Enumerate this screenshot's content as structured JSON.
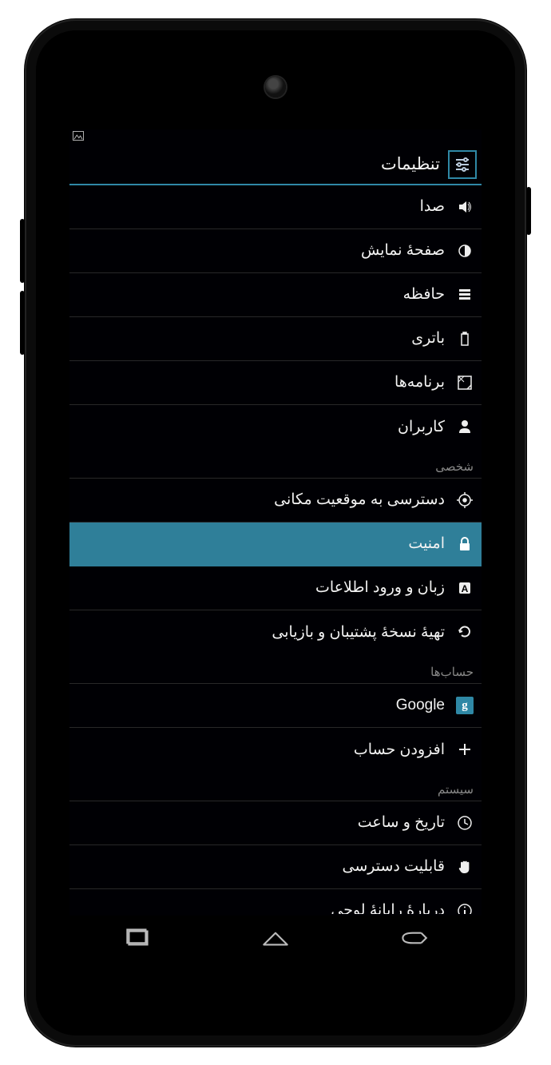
{
  "header": {
    "title": "تنظیمات"
  },
  "sections": {
    "device_rows": [
      {
        "id": "sound",
        "label": "صدا"
      },
      {
        "id": "display",
        "label": "صفحهٔ نمایش"
      },
      {
        "id": "storage",
        "label": "حافظه"
      },
      {
        "id": "battery",
        "label": "باتری"
      },
      {
        "id": "apps",
        "label": "برنامه‌ها"
      },
      {
        "id": "users",
        "label": "کاربران"
      }
    ],
    "personal_title": "شخصی",
    "personal_rows": [
      {
        "id": "location",
        "label": "دسترسی به موقعیت مکانی"
      },
      {
        "id": "security",
        "label": "امنیت",
        "selected": true
      },
      {
        "id": "language",
        "label": "زبان و ورود اطلاعات"
      },
      {
        "id": "backup",
        "label": "تهیهٔ نسخهٔ پشتیبان و بازیابی"
      }
    ],
    "accounts_title": "حساب‌ها",
    "accounts_rows": [
      {
        "id": "google",
        "label": "Google"
      },
      {
        "id": "add_account",
        "label": "افزودن حساب"
      }
    ],
    "system_title": "سیستم",
    "system_rows": [
      {
        "id": "datetime",
        "label": "تاریخ و ساعت"
      },
      {
        "id": "accessibility",
        "label": "قابلیت دسترسی"
      },
      {
        "id": "about",
        "label": "دربارهٔ رایانهٔ لوحی"
      }
    ]
  },
  "colors": {
    "accent": "#2f88a6",
    "selected": "#2f7f99",
    "divider": "#282828",
    "bg": "#000004",
    "section_text": "#888888"
  }
}
